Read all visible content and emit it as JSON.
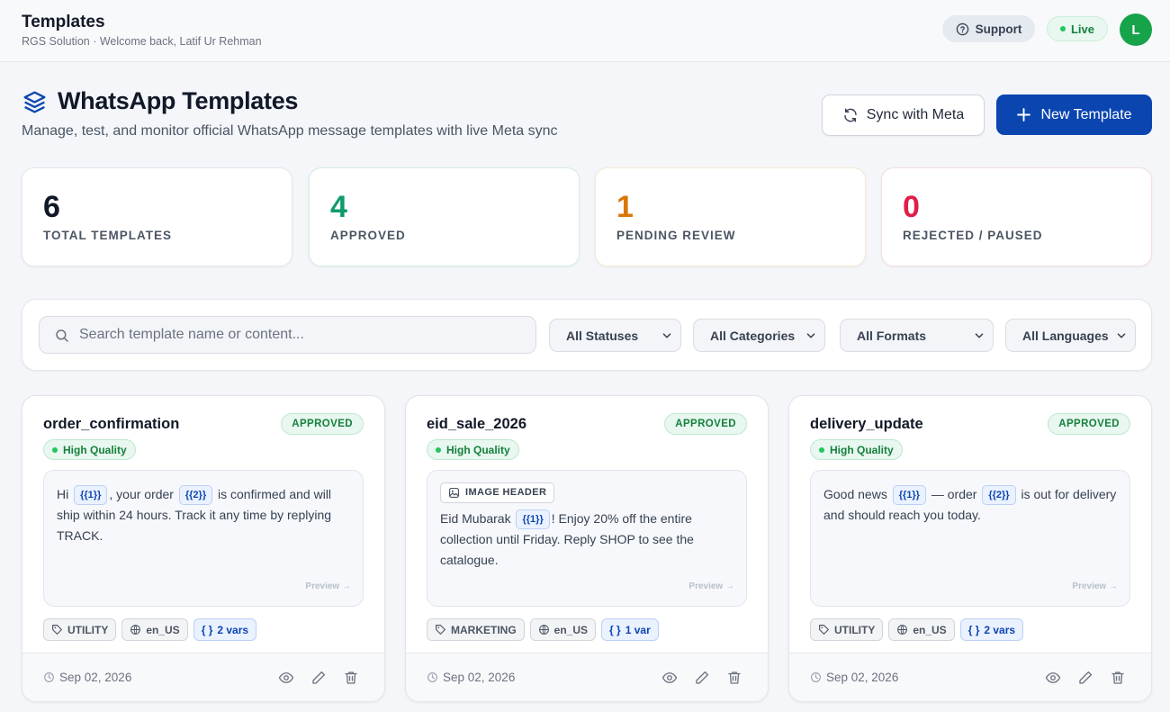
{
  "topbar": {
    "title": "Templates",
    "subtitle": "RGS Solution · Welcome back, Latif Ur Rehman",
    "support_label": "Support",
    "live_label": "Live",
    "avatar_initial": "L"
  },
  "page": {
    "title": "WhatsApp Templates",
    "description": "Manage, test, and monitor official WhatsApp message templates with live Meta sync",
    "sync_label": "Sync with Meta",
    "new_label": "New Template"
  },
  "stats": [
    {
      "value": "6",
      "label": "TOTAL TEMPLATES",
      "color": "#111827"
    },
    {
      "value": "4",
      "label": "APPROVED",
      "color": "#0f9a6e"
    },
    {
      "value": "1",
      "label": "PENDING REVIEW",
      "color": "#d97706"
    },
    {
      "value": "0",
      "label": "REJECTED / PAUSED",
      "color": "#e11d48"
    }
  ],
  "filters": {
    "search_placeholder": "Search template name or content...",
    "status": "All Statuses",
    "category": "All Categories",
    "format": "All Formats",
    "language": "All Languages"
  },
  "cards": [
    {
      "name": "order_confirmation",
      "status": "APPROVED",
      "quality": "High Quality",
      "body_parts": [
        "Hi ",
        "{{1}}",
        ", your order ",
        "{{2}}",
        " is confirmed and will ship within 24 hours. Track it any time by replying TRACK."
      ],
      "preview": "Preview →",
      "category": "UTILITY",
      "language": "en_US",
      "vars": "2 vars",
      "date": "Sep 02, 2026"
    },
    {
      "name": "eid_sale_2026",
      "status": "APPROVED",
      "quality": "High Quality",
      "header_label": "IMAGE HEADER",
      "body_parts": [
        "Eid Mubarak ",
        "{{1}}",
        "! Enjoy 20% off the entire collection until Friday. Reply SHOP to see the catalogue."
      ],
      "preview": "Preview →",
      "category": "MARKETING",
      "language": "en_US",
      "vars": "1 var",
      "date": "Sep 02, 2026"
    },
    {
      "name": "delivery_update",
      "status": "APPROVED",
      "quality": "High Quality",
      "body_parts": [
        "Good news ",
        "{{1}}",
        " — order ",
        "{{2}}",
        " is out for delivery and should reach you today."
      ],
      "preview": "Preview →",
      "category": "UTILITY",
      "language": "en_US",
      "vars": "2 vars",
      "date": "Sep 02, 2026"
    }
  ],
  "colors": {
    "primary": "#0b45b0",
    "success": "#15803d",
    "avatar": "#16a34a"
  }
}
